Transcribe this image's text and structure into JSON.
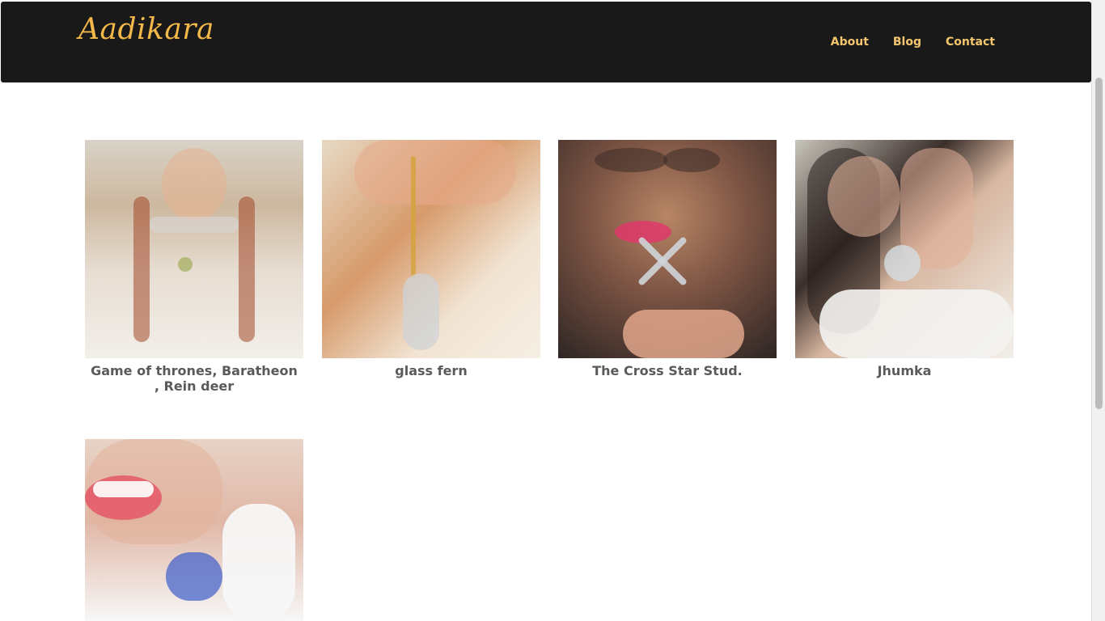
{
  "header": {
    "logo_text": "Aadikara",
    "nav": [
      {
        "label": "About"
      },
      {
        "label": "Blog"
      },
      {
        "label": "Contact"
      }
    ]
  },
  "gallery": {
    "items": [
      {
        "caption": "Game of thrones, Baratheon , Rein deer"
      },
      {
        "caption": "glass fern"
      },
      {
        "caption": "The Cross Star Stud."
      },
      {
        "caption": "Jhumka"
      },
      {
        "caption": ""
      }
    ]
  },
  "colors": {
    "header_bg": "#1a1919",
    "accent": "#f3c66e",
    "caption_text": "#5a5a5a"
  }
}
